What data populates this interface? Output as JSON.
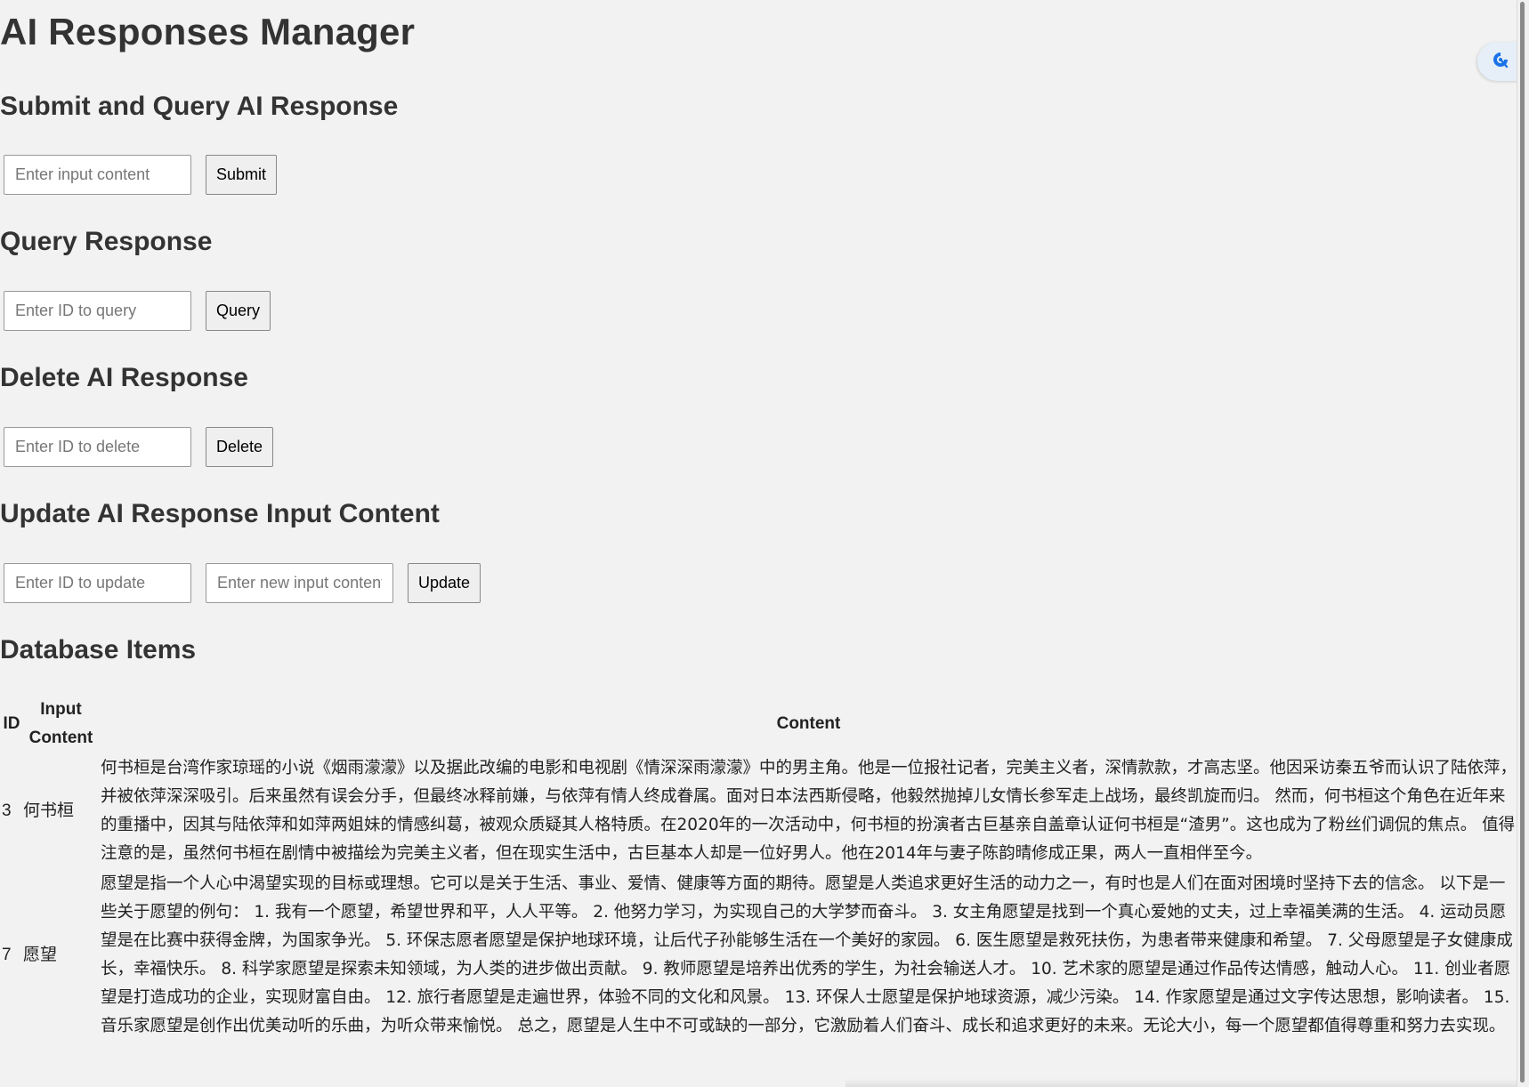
{
  "app": {
    "title": "AI Responses Manager"
  },
  "submit": {
    "heading": "Submit and Query AI Response",
    "placeholder": "Enter input content",
    "button": "Submit"
  },
  "query": {
    "heading": "Query Response",
    "placeholder": "Enter ID to query",
    "button": "Query"
  },
  "delete": {
    "heading": "Delete AI Response",
    "placeholder": "Enter ID to delete",
    "button": "Delete"
  },
  "update": {
    "heading": "Update AI Response Input Content",
    "id_placeholder": "Enter ID to update",
    "content_placeholder": "Enter new input content",
    "button": "Update"
  },
  "database": {
    "heading": "Database Items",
    "columns": [
      "ID",
      "Input Content",
      "Content"
    ],
    "rows": [
      {
        "id": "3",
        "input": "何书桓",
        "content": "何书桓是台湾作家琼瑶的小说《烟雨濛濛》以及据此改编的电影和电视剧《情深深雨濛濛》中的男主角。他是一位报社记者，完美主义者，深情款款，才高志坚。他因采访秦五爷而认识了陆依萍，并被依萍深深吸引。后来虽然有误会分手，但最终冰释前嫌，与依萍有情人终成眷属。面对日本法西斯侵略，他毅然抛掉儿女情长参军走上战场，最终凯旋而归。 然而，何书桓这个角色在近年来的重播中，因其与陆依萍和如萍两姐妹的情感纠葛，被观众质疑其人格特质。在2020年的一次活动中，何书桓的扮演者古巨基亲自盖章认证何书桓是“渣男”。这也成为了粉丝们调侃的焦点。 值得注意的是，虽然何书桓在剧情中被描绘为完美主义者，但在现实生活中，古巨基本人却是一位好男人。他在2014年与妻子陈韵晴修成正果，两人一直相伴至今。"
      },
      {
        "id": "7",
        "input": "愿望",
        "content": "愿望是指一个人心中渴望实现的目标或理想。它可以是关于生活、事业、爱情、健康等方面的期待。愿望是人类追求更好生活的动力之一，有时也是人们在面对困境时坚持下去的信念。 以下是一些关于愿望的例句： 1. 我有一个愿望，希望世界和平，人人平等。 2. 他努力学习，为实现自己的大学梦而奋斗。 3. 女主角愿望是找到一个真心爱她的丈夫，过上幸福美满的生活。 4. 运动员愿望是在比赛中获得金牌，为国家争光。 5. 环保志愿者愿望是保护地球环境，让后代子孙能够生活在一个美好的家园。 6. 医生愿望是救死扶伤，为患者带来健康和希望。 7. 父母愿望是子女健康成长，幸福快乐。 8. 科学家愿望是探索未知领域，为人类的进步做出贡献。 9. 教师愿望是培养出优秀的学生，为社会输送人才。 10. 艺术家的愿望是通过作品传达情感，触动人心。 11. 创业者愿望是打造成功的企业，实现财富自由。 12. 旅行者愿望是走遍世界，体验不同的文化和风景。 13. 环保人士愿望是保护地球资源，减少污染。 14. 作家愿望是通过文字传达思想，影响读者。 15. 音乐家愿望是创作出优美动听的乐曲，为听众带来愉悦。 总之，愿望是人生中不可或缺的一部分，它激励着人们奋斗、成长和追求更好的未来。无论大小，每一个愿望都值得尊重和努力去实现。"
      }
    ]
  },
  "extension": {
    "icon": "extension-icon",
    "color": "#1a73e8"
  }
}
